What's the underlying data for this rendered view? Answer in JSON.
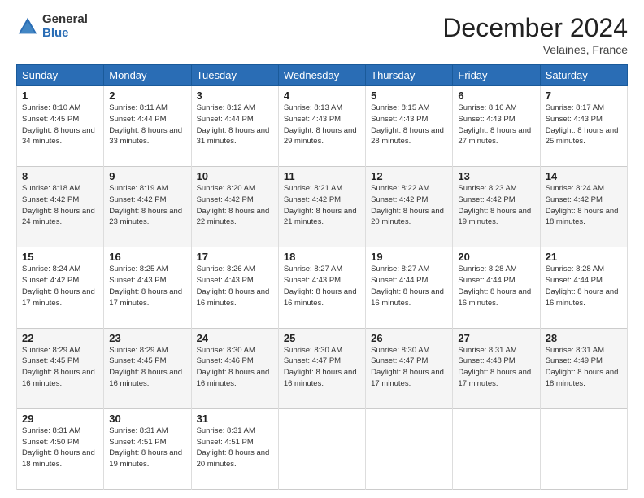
{
  "header": {
    "logo_general": "General",
    "logo_blue": "Blue",
    "month_title": "December 2024",
    "location": "Velaines, France"
  },
  "days_of_week": [
    "Sunday",
    "Monday",
    "Tuesday",
    "Wednesday",
    "Thursday",
    "Friday",
    "Saturday"
  ],
  "weeks": [
    [
      {
        "day": "1",
        "sunrise": "Sunrise: 8:10 AM",
        "sunset": "Sunset: 4:45 PM",
        "daylight": "Daylight: 8 hours and 34 minutes."
      },
      {
        "day": "2",
        "sunrise": "Sunrise: 8:11 AM",
        "sunset": "Sunset: 4:44 PM",
        "daylight": "Daylight: 8 hours and 33 minutes."
      },
      {
        "day": "3",
        "sunrise": "Sunrise: 8:12 AM",
        "sunset": "Sunset: 4:44 PM",
        "daylight": "Daylight: 8 hours and 31 minutes."
      },
      {
        "day": "4",
        "sunrise": "Sunrise: 8:13 AM",
        "sunset": "Sunset: 4:43 PM",
        "daylight": "Daylight: 8 hours and 29 minutes."
      },
      {
        "day": "5",
        "sunrise": "Sunrise: 8:15 AM",
        "sunset": "Sunset: 4:43 PM",
        "daylight": "Daylight: 8 hours and 28 minutes."
      },
      {
        "day": "6",
        "sunrise": "Sunrise: 8:16 AM",
        "sunset": "Sunset: 4:43 PM",
        "daylight": "Daylight: 8 hours and 27 minutes."
      },
      {
        "day": "7",
        "sunrise": "Sunrise: 8:17 AM",
        "sunset": "Sunset: 4:43 PM",
        "daylight": "Daylight: 8 hours and 25 minutes."
      }
    ],
    [
      {
        "day": "8",
        "sunrise": "Sunrise: 8:18 AM",
        "sunset": "Sunset: 4:42 PM",
        "daylight": "Daylight: 8 hours and 24 minutes."
      },
      {
        "day": "9",
        "sunrise": "Sunrise: 8:19 AM",
        "sunset": "Sunset: 4:42 PM",
        "daylight": "Daylight: 8 hours and 23 minutes."
      },
      {
        "day": "10",
        "sunrise": "Sunrise: 8:20 AM",
        "sunset": "Sunset: 4:42 PM",
        "daylight": "Daylight: 8 hours and 22 minutes."
      },
      {
        "day": "11",
        "sunrise": "Sunrise: 8:21 AM",
        "sunset": "Sunset: 4:42 PM",
        "daylight": "Daylight: 8 hours and 21 minutes."
      },
      {
        "day": "12",
        "sunrise": "Sunrise: 8:22 AM",
        "sunset": "Sunset: 4:42 PM",
        "daylight": "Daylight: 8 hours and 20 minutes."
      },
      {
        "day": "13",
        "sunrise": "Sunrise: 8:23 AM",
        "sunset": "Sunset: 4:42 PM",
        "daylight": "Daylight: 8 hours and 19 minutes."
      },
      {
        "day": "14",
        "sunrise": "Sunrise: 8:24 AM",
        "sunset": "Sunset: 4:42 PM",
        "daylight": "Daylight: 8 hours and 18 minutes."
      }
    ],
    [
      {
        "day": "15",
        "sunrise": "Sunrise: 8:24 AM",
        "sunset": "Sunset: 4:42 PM",
        "daylight": "Daylight: 8 hours and 17 minutes."
      },
      {
        "day": "16",
        "sunrise": "Sunrise: 8:25 AM",
        "sunset": "Sunset: 4:43 PM",
        "daylight": "Daylight: 8 hours and 17 minutes."
      },
      {
        "day": "17",
        "sunrise": "Sunrise: 8:26 AM",
        "sunset": "Sunset: 4:43 PM",
        "daylight": "Daylight: 8 hours and 16 minutes."
      },
      {
        "day": "18",
        "sunrise": "Sunrise: 8:27 AM",
        "sunset": "Sunset: 4:43 PM",
        "daylight": "Daylight: 8 hours and 16 minutes."
      },
      {
        "day": "19",
        "sunrise": "Sunrise: 8:27 AM",
        "sunset": "Sunset: 4:44 PM",
        "daylight": "Daylight: 8 hours and 16 minutes."
      },
      {
        "day": "20",
        "sunrise": "Sunrise: 8:28 AM",
        "sunset": "Sunset: 4:44 PM",
        "daylight": "Daylight: 8 hours and 16 minutes."
      },
      {
        "day": "21",
        "sunrise": "Sunrise: 8:28 AM",
        "sunset": "Sunset: 4:44 PM",
        "daylight": "Daylight: 8 hours and 16 minutes."
      }
    ],
    [
      {
        "day": "22",
        "sunrise": "Sunrise: 8:29 AM",
        "sunset": "Sunset: 4:45 PM",
        "daylight": "Daylight: 8 hours and 16 minutes."
      },
      {
        "day": "23",
        "sunrise": "Sunrise: 8:29 AM",
        "sunset": "Sunset: 4:45 PM",
        "daylight": "Daylight: 8 hours and 16 minutes."
      },
      {
        "day": "24",
        "sunrise": "Sunrise: 8:30 AM",
        "sunset": "Sunset: 4:46 PM",
        "daylight": "Daylight: 8 hours and 16 minutes."
      },
      {
        "day": "25",
        "sunrise": "Sunrise: 8:30 AM",
        "sunset": "Sunset: 4:47 PM",
        "daylight": "Daylight: 8 hours and 16 minutes."
      },
      {
        "day": "26",
        "sunrise": "Sunrise: 8:30 AM",
        "sunset": "Sunset: 4:47 PM",
        "daylight": "Daylight: 8 hours and 17 minutes."
      },
      {
        "day": "27",
        "sunrise": "Sunrise: 8:31 AM",
        "sunset": "Sunset: 4:48 PM",
        "daylight": "Daylight: 8 hours and 17 minutes."
      },
      {
        "day": "28",
        "sunrise": "Sunrise: 8:31 AM",
        "sunset": "Sunset: 4:49 PM",
        "daylight": "Daylight: 8 hours and 18 minutes."
      }
    ],
    [
      {
        "day": "29",
        "sunrise": "Sunrise: 8:31 AM",
        "sunset": "Sunset: 4:50 PM",
        "daylight": "Daylight: 8 hours and 18 minutes."
      },
      {
        "day": "30",
        "sunrise": "Sunrise: 8:31 AM",
        "sunset": "Sunset: 4:51 PM",
        "daylight": "Daylight: 8 hours and 19 minutes."
      },
      {
        "day": "31",
        "sunrise": "Sunrise: 8:31 AM",
        "sunset": "Sunset: 4:51 PM",
        "daylight": "Daylight: 8 hours and 20 minutes."
      },
      null,
      null,
      null,
      null
    ]
  ]
}
